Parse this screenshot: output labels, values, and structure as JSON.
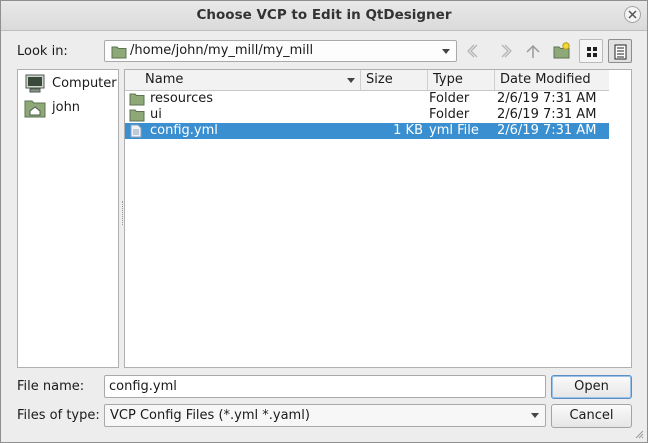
{
  "window": {
    "title": "Choose VCP to Edit in QtDesigner"
  },
  "toolbar": {
    "look_in_label": "Look in:",
    "path": "/home/john/my_mill/my_mill"
  },
  "sidebar": {
    "items": [
      {
        "label": "Computer",
        "icon": "computer-icon"
      },
      {
        "label": "john",
        "icon": "home-folder-icon"
      }
    ]
  },
  "file_list": {
    "columns": [
      "Name",
      "Size",
      "Type",
      "Date Modified"
    ],
    "rows": [
      {
        "name": "resources",
        "size": "",
        "type": "Folder",
        "date": "2/6/19 7:31 AM",
        "icon": "folder-icon",
        "selected": false
      },
      {
        "name": "ui",
        "size": "",
        "type": "Folder",
        "date": "2/6/19 7:31 AM",
        "icon": "folder-icon",
        "selected": false
      },
      {
        "name": "config.yml",
        "size": "1 KB",
        "type": "yml File",
        "date": "2/6/19 7:31 AM",
        "icon": "file-icon",
        "selected": true
      }
    ]
  },
  "footer": {
    "file_name_label": "File name:",
    "file_name_value": "config.yml",
    "files_of_type_label": "Files of type:",
    "files_of_type_value": "VCP Config Files (*.yml *.yaml)",
    "open_label": "Open",
    "cancel_label": "Cancel"
  },
  "colors": {
    "selection": "#3a8fd0",
    "folder": "#8fa878",
    "accent": "#5a8fc6"
  }
}
